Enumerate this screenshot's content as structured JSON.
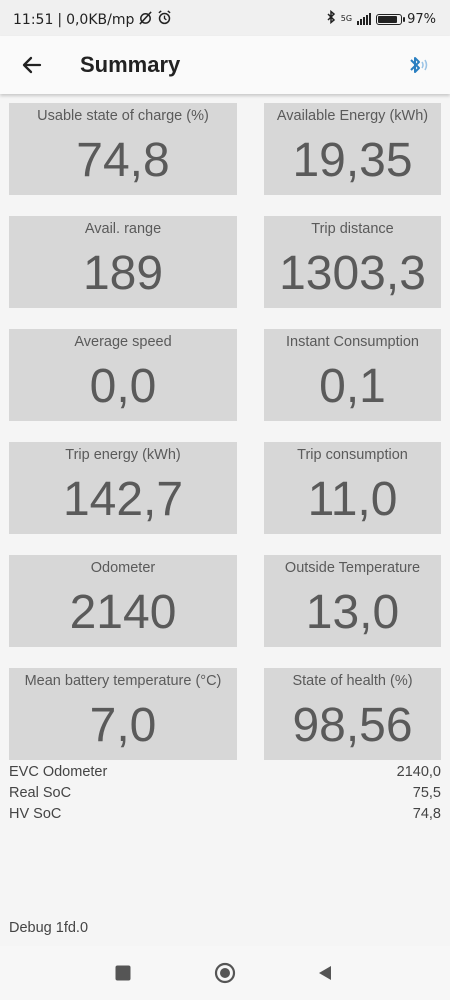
{
  "status_bar": {
    "time": "11:51",
    "network_speed": "0,0KB/mp",
    "network_type": "5G",
    "battery_percent": "97",
    "battery_level": 0.97
  },
  "app_bar": {
    "title": "Summary"
  },
  "tiles": [
    {
      "label": "Usable state of charge (%)",
      "value": "74,8"
    },
    {
      "label": "Available Energy (kWh)",
      "value": "19,35"
    },
    {
      "label": "Avail. range",
      "value": "189"
    },
    {
      "label": "Trip distance",
      "value": "1303,3"
    },
    {
      "label": "Average speed",
      "value": "0,0"
    },
    {
      "label": "Instant Consumption",
      "value": "0,1"
    },
    {
      "label": "Trip energy (kWh)",
      "value": "142,7"
    },
    {
      "label": "Trip consumption",
      "value": "11,0"
    },
    {
      "label": "Odometer",
      "value": "2140"
    },
    {
      "label": "Outside Temperature",
      "value": "13,0"
    },
    {
      "label": "Mean battery temperature (°C)",
      "value": "7,0"
    },
    {
      "label": "State of health (%)",
      "value": "98,56"
    }
  ],
  "details": [
    {
      "label": "EVC Odometer",
      "value": "2140,0"
    },
    {
      "label": "Real SoC",
      "value": "75,5"
    },
    {
      "label": "HV SoC",
      "value": "74,8"
    }
  ],
  "debug": "Debug 1fd.0",
  "colors": {
    "tile_bg": "#d7d7d7",
    "tile_text": "#5a5a5a",
    "bluetooth_accent": "#2a7fc1"
  },
  "icons": {
    "back": "arrow-back-icon",
    "bluetooth": "bluetooth-audio-icon",
    "nav_recents": "square-icon",
    "nav_home": "circle-icon",
    "nav_back": "triangle-back-icon"
  }
}
